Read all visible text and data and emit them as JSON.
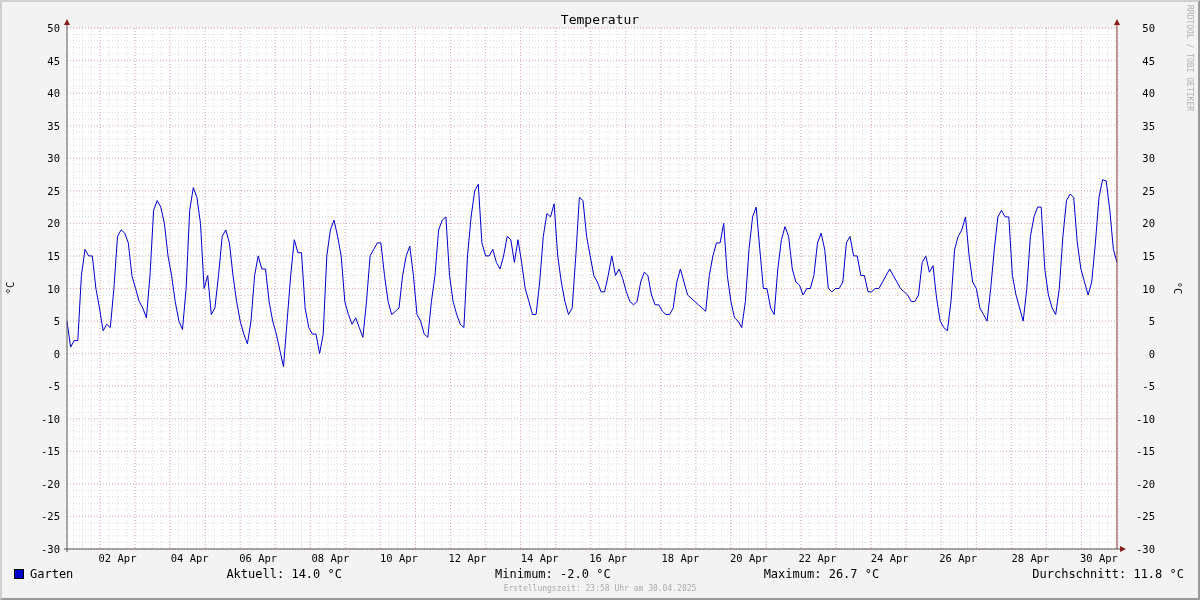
{
  "title": "Temperatur",
  "side_text": "RRDTOOL / TOBI OETIKER",
  "chart_data": {
    "type": "line",
    "grid": true,
    "ylabel": "°C",
    "ylim": [
      -30,
      50
    ],
    "categories": [
      null,
      null,
      null,
      null,
      null,
      null,
      null,
      null,
      null,
      null,
      null,
      null,
      null,
      null,
      "02 Apr",
      null,
      null,
      null,
      null,
      null,
      null,
      null,
      null,
      null,
      null,
      null,
      null,
      null,
      null,
      null,
      null,
      null,
      null,
      null,
      "04 Apr",
      null,
      null,
      null,
      null,
      null,
      null,
      null,
      null,
      null,
      null,
      null,
      null,
      null,
      null,
      null,
      null,
      null,
      null,
      "06 Apr",
      null,
      null,
      null,
      null,
      null,
      null,
      null,
      null,
      null,
      null,
      null,
      null,
      null,
      null,
      null,
      null,
      null,
      null,
      null,
      "08 Apr",
      null,
      null,
      null,
      null,
      null,
      null,
      null,
      null,
      null,
      null,
      null,
      null,
      null,
      null,
      null,
      null,
      null,
      null,
      "10 Apr",
      null,
      null,
      null,
      null,
      null,
      null,
      null,
      null,
      null,
      null,
      null,
      null,
      null,
      null,
      null,
      null,
      null,
      null,
      "12 Apr",
      null,
      null,
      null,
      null,
      null,
      null,
      null,
      null,
      null,
      null,
      null,
      null,
      null,
      null,
      null,
      null,
      null,
      null,
      null,
      "14 Apr",
      null,
      null,
      null,
      null,
      null,
      null,
      null,
      null,
      null,
      null,
      null,
      null,
      null,
      null,
      null,
      null,
      null,
      null,
      "16 Apr",
      null,
      null,
      null,
      null,
      null,
      null,
      null,
      null,
      null,
      null,
      null,
      null,
      null,
      null,
      null,
      null,
      null,
      null,
      null,
      "18 Apr",
      null,
      null,
      null,
      null,
      null,
      null,
      null,
      null,
      null,
      null,
      null,
      null,
      null,
      null,
      null,
      null,
      null,
      null,
      "20 Apr",
      null,
      null,
      null,
      null,
      null,
      null,
      null,
      null,
      null,
      null,
      null,
      null,
      null,
      null,
      null,
      null,
      null,
      null,
      "22 Apr",
      null,
      null,
      null,
      null,
      null,
      null,
      null,
      null,
      null,
      null,
      null,
      null,
      null,
      null,
      null,
      null,
      null,
      null,
      null,
      "24 Apr",
      null,
      null,
      null,
      null,
      null,
      null,
      null,
      null,
      null,
      null,
      null,
      null,
      null,
      null,
      null,
      null,
      null,
      null,
      "26 Apr",
      null,
      null,
      null,
      null,
      null,
      null,
      null,
      null,
      null,
      null,
      null,
      null,
      null,
      null,
      null,
      null,
      null,
      null,
      null,
      "28 Apr",
      null,
      null,
      null,
      null,
      null,
      null,
      null,
      null,
      null,
      null,
      null,
      null,
      null,
      null,
      null,
      null,
      null,
      null,
      "30 Apr",
      null,
      null,
      null,
      null,
      null
    ],
    "yticks": [
      50,
      45,
      40,
      35,
      30,
      25,
      20,
      15,
      10,
      5,
      0,
      -5,
      -10,
      -15,
      -20,
      -25,
      -30
    ],
    "series": [
      {
        "name": "Garten",
        "color": "#0000cc",
        "values": [
          5,
          1,
          2,
          2,
          12,
          16,
          15,
          15,
          10,
          7,
          3.5,
          4.5,
          4,
          10,
          18,
          19,
          18.5,
          17,
          12,
          10,
          8,
          7,
          5.5,
          12,
          22,
          23.5,
          22.5,
          20,
          15,
          12,
          8,
          5,
          3.7,
          10,
          22,
          25.5,
          24,
          20,
          10,
          12,
          6,
          7,
          12,
          18,
          19,
          17,
          12,
          8,
          5,
          3,
          1.5,
          5,
          12,
          15,
          13,
          13,
          8,
          5,
          3,
          0.5,
          -2,
          5,
          12,
          17.5,
          15.5,
          15.5,
          7,
          4,
          3,
          3,
          0,
          3,
          15,
          19,
          20.5,
          18,
          15,
          8,
          6,
          4.5,
          5.5,
          4,
          2.5,
          8,
          15,
          16,
          17,
          17,
          12,
          8,
          6,
          6.5,
          7,
          12,
          15,
          16.5,
          12,
          6,
          5,
          3,
          2.5,
          8,
          12,
          19,
          20.5,
          21,
          12,
          8,
          6,
          4.5,
          4,
          15,
          21,
          25,
          26,
          17,
          15,
          15,
          16,
          14,
          13,
          15,
          18,
          17.5,
          14,
          17.5,
          14,
          10,
          8,
          6,
          6,
          11,
          18,
          21.5,
          21,
          23,
          15,
          11,
          8,
          6,
          7,
          15,
          24,
          23.5,
          18,
          15,
          12,
          11,
          9.5,
          9.5,
          12,
          15,
          12,
          13,
          11.5,
          9.5,
          8,
          7.5,
          8,
          11,
          12.5,
          12,
          9,
          7.5,
          7.5,
          6.5,
          6,
          6,
          7,
          11,
          13,
          11,
          9,
          8.5,
          8,
          7.5,
          7,
          6.5,
          12,
          15,
          17,
          17,
          20,
          12,
          8,
          5.5,
          5,
          4,
          8,
          16,
          21,
          22.5,
          16,
          10,
          10,
          7,
          6,
          13,
          17.5,
          19.5,
          18,
          13,
          11,
          10.5,
          9,
          10,
          10,
          12,
          17,
          18.5,
          16,
          10,
          9.5,
          10,
          10,
          11,
          17,
          18,
          15,
          15,
          12,
          12,
          9.5,
          9.5,
          10,
          10,
          11,
          12,
          13,
          12,
          11,
          10,
          9.5,
          9,
          8,
          8,
          9,
          14,
          15,
          12.5,
          13.5,
          8.5,
          5,
          4,
          3.5,
          8,
          16,
          18,
          19,
          21,
          15,
          11,
          10,
          7,
          6,
          5,
          10,
          16,
          21,
          22,
          21,
          21,
          12,
          9,
          7,
          5,
          10,
          18,
          21,
          22.5,
          22.5,
          13,
          9,
          7,
          6,
          10,
          18,
          23.5,
          24.5,
          24,
          17,
          13,
          11,
          9,
          11,
          17,
          24,
          26.7,
          26.5,
          22,
          16,
          14
        ]
      }
    ]
  },
  "right_axis": {
    "label": "°C",
    "ticks": [
      "50",
      "45",
      "40",
      "35",
      "30",
      "25",
      "20",
      "15",
      "10",
      "5",
      "0",
      "-5",
      "-10",
      "-15",
      "-20",
      "-25",
      "-30"
    ]
  },
  "stats": [
    "Aktuell: 14.0 °C",
    "Minimum: -2.0 °C",
    "Maximum: 26.7 °C",
    "Durchschnitt: 11.8 °C"
  ],
  "footer": "Erstellungszeit: 23:58 Uhr am 30.04.2025"
}
